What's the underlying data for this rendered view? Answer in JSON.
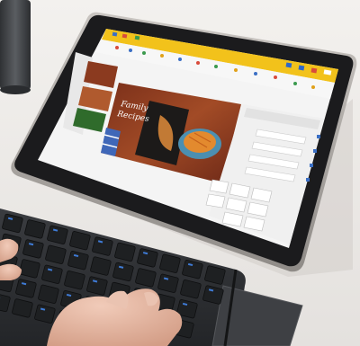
{
  "photo": {
    "description_subject": "tablet-with-keyboard",
    "colors": {
      "desk": "#ece9e6",
      "tablet_bezel": "#1b1b1d",
      "tablet_edge": "#a9a5a1",
      "app_toolbar": "#f2c21b",
      "screen_bg": "#f4f4f4",
      "keyboard": "#2a2c2f",
      "key": "#1e2022",
      "key_blue_legend": "#3f7bd6",
      "hand_skin": "#e7b9a6",
      "mug": "#4b4d50"
    }
  },
  "slide": {
    "title_line1": "Family",
    "title_line2": "Recipes"
  },
  "icons": {
    "toolbar_icons": "various-toolbar-icons",
    "slide_thumbnails": 3
  }
}
